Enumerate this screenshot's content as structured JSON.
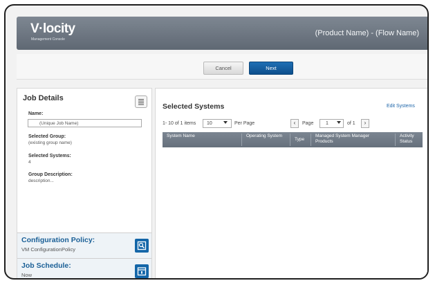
{
  "header": {
    "logo": "V·locity",
    "logo_sub": "Management Console",
    "flow_title": "(Product Name) - (Flow Name)"
  },
  "actions": {
    "cancel": "Cancel",
    "next": "Next"
  },
  "job_details": {
    "title": "Job Details",
    "name_label": "Name:",
    "name_value": "(Unique Job Name)",
    "group_label": "Selected Group:",
    "group_value": "(existing group name)",
    "systems_label": "Selected Systems:",
    "systems_value": "4",
    "desc_label": "Group Description:",
    "desc_value": "description..."
  },
  "config_policy": {
    "title": "Configuration Policy:",
    "value": "VM ConfigurationPolicy"
  },
  "job_schedule": {
    "title": "Job Schedule:",
    "value": "Now"
  },
  "selected_systems": {
    "title": "Selected Systems",
    "edit_link": "Edit Systems",
    "items_text": "1- 10 of 1 items",
    "per_page_value": "10",
    "per_page_label": "Per Page",
    "page_label": "Page",
    "page_value": "1",
    "of_text": "of 1",
    "columns": [
      "System Name",
      "Operating System",
      "Type",
      "Managed Products",
      "System Manager",
      "Activity Status"
    ]
  },
  "icons": {
    "list": "list-icon",
    "config": "search-edit-icon",
    "schedule": "calendar-icon",
    "prev": "chevron-left-icon",
    "next": "chevron-right-icon",
    "dropdown": "chevron-down-icon"
  },
  "colors": {
    "header": "#6a737e",
    "accent": "#1466a8",
    "table_header": "#707a86"
  }
}
